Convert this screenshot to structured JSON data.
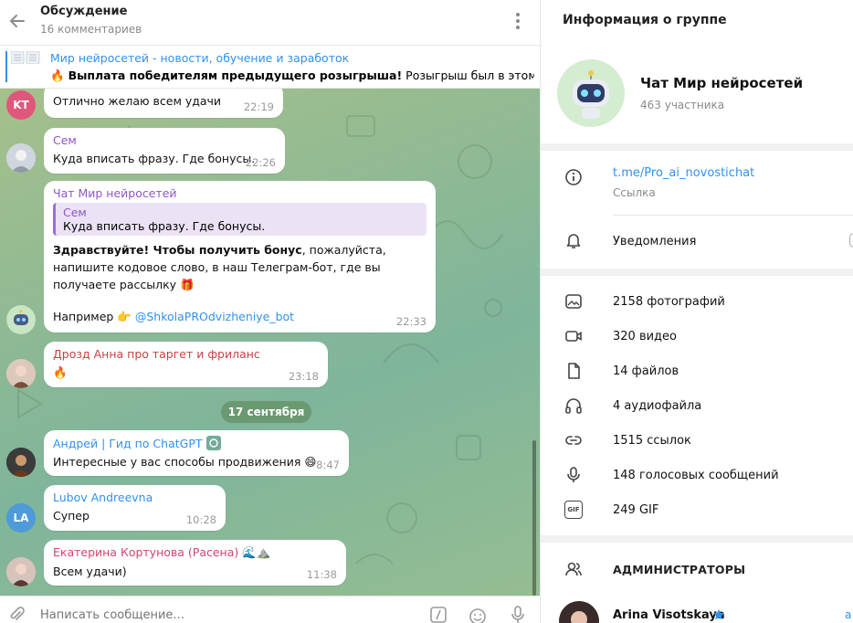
{
  "discussion": {
    "title": "Обсуждение",
    "subtitle": "16 комментариев"
  },
  "pinned": {
    "title": "Мир нейросетей - новости, обучение и заработок",
    "emoji": "🔥",
    "text_bold": "Выплата победителям предыдущего розыгрыша!",
    "text_rest": "Розыгрыш был в этом п..."
  },
  "messages": [
    {
      "avatar_initials": "KT",
      "avatar_color": "#e0577b",
      "text": "Отлично желаю всем удачи",
      "time": "22:19"
    },
    {
      "name": "Сем",
      "name_color": "#8f55c7",
      "text": "Куда вписать фразу. Где бонусы.",
      "time": "22:26"
    },
    {
      "name": "Чат Мир нейросетей",
      "name_color": "#8f55c7",
      "quote_name": "Сем",
      "quote_text": "Куда вписать фразу. Где бонусы.",
      "text_bold": "Здравствуйте! Чтобы получить бонус",
      "text_rest": ", пожалуйста, напишите кодовое слово, в наш Телеграм-бот, где вы получаете рассылку 🎁",
      "example_label": "Например 👉",
      "mention": "@ShkolaPROdvizheniye_bot",
      "time": "22:33"
    },
    {
      "name": "Дрозд Анна про таргет и фриланс",
      "name_color": "#c74343",
      "text": "🔥",
      "time": "23:18"
    },
    {
      "name": "Андрей | Гид по ChatGPT",
      "name_color": "#3390ec",
      "text": "Интересные у вас способы продвижения 😄",
      "time": "8:47"
    },
    {
      "avatar_initials": "LA",
      "avatar_color": "#4f9ad8",
      "name": "Lubov Andreevna",
      "name_color": "#3390ec",
      "text": "Супер",
      "time": "10:28"
    },
    {
      "name": "Екатерина Кортунова (Расена) 🌊⛰️",
      "name_color": "#d2456e",
      "text": "Всем удачи)",
      "time": "11:38"
    }
  ],
  "date_separator": "17 сентября",
  "composer": {
    "placeholder": "Написать сообщение..."
  },
  "info": {
    "title": "Информация о группе",
    "group_name": "Чат Мир нейросетей",
    "members": "463 участника",
    "link": "t.me/Pro_ai_novostichat",
    "link_label": "Ссылка",
    "notifications": "Уведомления",
    "media": [
      {
        "icon": "photo-icon",
        "label": "2158 фотографий"
      },
      {
        "icon": "video-icon",
        "label": "320 видео"
      },
      {
        "icon": "file-icon",
        "label": "14 файлов"
      },
      {
        "icon": "headphones-icon",
        "label": "4 аудиофайла"
      },
      {
        "icon": "link-icon",
        "label": "1515 ссылок"
      },
      {
        "icon": "microphone-icon",
        "label": "148 голосовых сообщений"
      },
      {
        "icon": "gif-icon",
        "label": "249 GIF",
        "badge": "GIF"
      }
    ],
    "admins_title": "АДМИНИСТРАТОРЫ",
    "admin_name": "Arina Visotskaya",
    "admin_role_edge": "a"
  },
  "colors": {
    "accent": "#3390ec",
    "chat_bg": "#8fb994"
  }
}
